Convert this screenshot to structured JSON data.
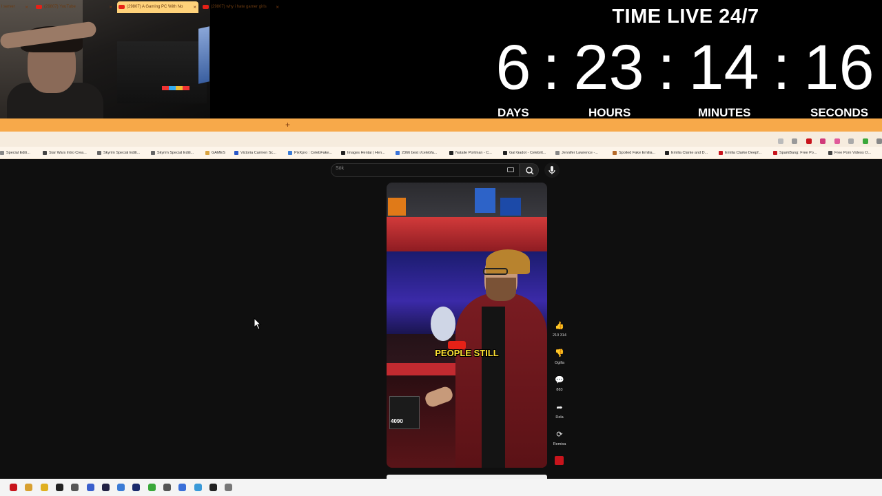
{
  "timer": {
    "title": "TIME LIVE 24/7",
    "days": "6",
    "hours": "23",
    "minutes": "14",
    "seconds": "16",
    "separator": ":",
    "days_label": "DAYS",
    "hours_label": "HOURS",
    "minutes_label": "MINUTES",
    "seconds_label": "SECONDS"
  },
  "tabs": [
    {
      "label": "l server",
      "active": false
    },
    {
      "label": "(29807) YouTube",
      "active": false
    },
    {
      "label": "(29807) A Gaming PC With No",
      "active": true
    },
    {
      "label": "(29807) why i hate gamer girls",
      "active": false
    }
  ],
  "new_tab_label": "+",
  "close_label": "×",
  "bookmarks": [
    {
      "label": "Special Editi...",
      "color": "#888888"
    },
    {
      "label": "Star Wars Intro Crea...",
      "color": "#444444"
    },
    {
      "label": "Skyrim Special Editi...",
      "color": "#666666"
    },
    {
      "label": "Skyrim Special Editi...",
      "color": "#666666"
    },
    {
      "label": "GAMES",
      "color": "#d9a441"
    },
    {
      "label": "Victoria Carmen Sc...",
      "color": "#2a58c8"
    },
    {
      "label": "PixKpro : CelebFake...",
      "color": "#3a7bd5"
    },
    {
      "label": "Images Hentai | Hen...",
      "color": "#222222"
    },
    {
      "label": "2366 best r/celebfa...",
      "color": "#3b74d9"
    },
    {
      "label": "Natalie Portman - C...",
      "color": "#222222"
    },
    {
      "label": "Gal Gadot - Celebrit...",
      "color": "#222222"
    },
    {
      "label": "Jennifer Lawrence -...",
      "color": "#888888"
    },
    {
      "label": "Spoiled Fake Emilia...",
      "color": "#b56a2a"
    },
    {
      "label": "Emilia Clarke and D...",
      "color": "#222222"
    },
    {
      "label": "Emilia Clarke Deepf...",
      "color": "#c8141c"
    },
    {
      "label": "SparkBang: Free Po...",
      "color": "#c8141c"
    },
    {
      "label": "Free Porn Videos O...",
      "color": "#444444"
    }
  ],
  "search": {
    "placeholder": "Sök"
  },
  "short": {
    "caption": "PEOPLE STILL",
    "gpu_label": "4090"
  },
  "actions": [
    {
      "icon": "👍",
      "label": "210 314",
      "name": "like"
    },
    {
      "icon": "👎",
      "label": "Ogilla",
      "name": "dislike"
    },
    {
      "icon": "💬",
      "label": "883",
      "name": "comments"
    },
    {
      "icon": "➦",
      "label": "Dela",
      "name": "share"
    },
    {
      "icon": "⟳",
      "label": "Remixa",
      "name": "remix"
    }
  ],
  "taskbar_icons": [
    "#c8141c",
    "#d8a030",
    "#e0b020",
    "#222222",
    "#555555",
    "#3a5fcc",
    "#222244",
    "#3a7bd5",
    "#1a2a6c",
    "#3aa83a",
    "#555555",
    "#3a6fd8",
    "#3a9ad8",
    "#222222",
    "#777777"
  ]
}
